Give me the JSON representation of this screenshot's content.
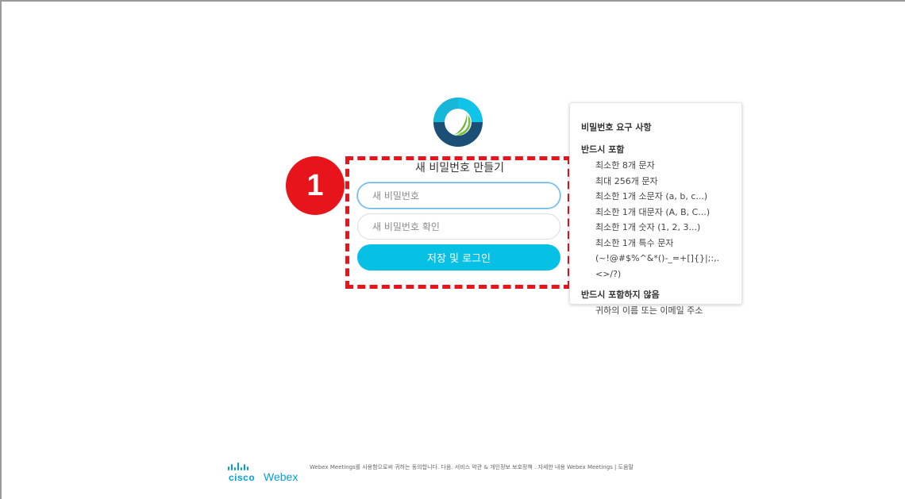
{
  "brand": {
    "logo_icon": "webex-logo-icon",
    "cisco_label": "cisco",
    "webex_label": "Webex",
    "colors": {
      "accent": "#07c1e4",
      "cisco_blue": "#049fd9",
      "highlight_red": "#e8141b"
    }
  },
  "annotation": {
    "step_number": "1"
  },
  "form": {
    "title": "새 비밀번호 만들기",
    "new_password_placeholder": "새 비밀번호",
    "confirm_password_placeholder": "새 비밀번호 확인",
    "submit_label": "저장 및 로그인"
  },
  "requirements": {
    "title": "비밀번호 요구 사항",
    "must_include_heading": "반드시 포함",
    "must_include": [
      "최소한 8개 문자",
      "최대 256개 문자",
      "최소한 1개 소문자 (a, b, c...)",
      "최소한 1개 대문자 (A, B, C...)",
      "최소한 1개 숫자 (1, 2, 3...)",
      "최소한 1개 특수 문자",
      "(~!@#$%^&*()-_=+[]{}|;:,.<>/?)"
    ],
    "must_not_include_heading": "반드시 포함하지 않음",
    "must_not_include": [
      "귀하의 이름 또는 이메일 주소"
    ]
  },
  "footer": {
    "text": "Webex Meetings를 사용함으로써 귀하는 동의합니다. 다음. 서비스 약관 & 개인정보 보호정책 . 자세한 내용 Webex Meetings | 도움말"
  }
}
